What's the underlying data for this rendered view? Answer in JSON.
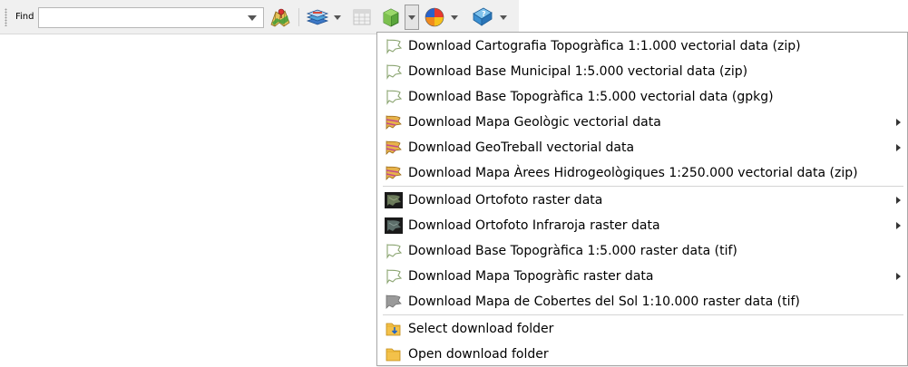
{
  "toolbar": {
    "find_label": "Find",
    "find_value": "",
    "icons": {
      "map": "map-icon",
      "layers": "layers-icon",
      "table": "table-icon",
      "download": "download-box-icon",
      "color": "color-wheel-icon",
      "help": "help-book-icon"
    }
  },
  "menu": {
    "items": [
      {
        "label": "Download Cartografia Topogràfica 1:1.000 vectorial data (zip)",
        "icon": "vector-outline-icon",
        "submenu": false
      },
      {
        "label": "Download Base Municipal 1:5.000 vectorial data (zip)",
        "icon": "vector-outline-icon",
        "submenu": false
      },
      {
        "label": "Download Base Topogràfica 1:5.000 vectorial data (gpkg)",
        "icon": "vector-outline-icon",
        "submenu": false
      },
      {
        "label": "Download Mapa Geològic vectorial data",
        "icon": "geology-map-icon",
        "submenu": true
      },
      {
        "label": "Download GeoTreball vectorial data",
        "icon": "geology-map-icon",
        "submenu": true
      },
      {
        "label": "Download Mapa Àrees Hidrogeològiques 1:250.000 vectorial data (zip)",
        "icon": "geology-map-icon",
        "submenu": false
      },
      {
        "label": "Download Ortofoto raster data",
        "icon": "orthophoto-icon",
        "submenu": true
      },
      {
        "label": "Download Ortofoto Infraroja raster data",
        "icon": "orthophoto-icon",
        "submenu": true
      },
      {
        "label": "Download Base Topogràfica 1:5.000 raster data (tif)",
        "icon": "vector-outline-icon",
        "submenu": false
      },
      {
        "label": "Download Mapa Topogràfic raster data",
        "icon": "vector-outline-icon",
        "submenu": true
      },
      {
        "label": "Download Mapa de Cobertes del Sol 1:10.000 raster data (tif)",
        "icon": "land-cover-icon",
        "submenu": false
      },
      {
        "label": "Select download folder",
        "icon": "folder-download-icon",
        "submenu": false
      },
      {
        "label": "Open download folder",
        "icon": "folder-icon",
        "submenu": false
      }
    ]
  }
}
